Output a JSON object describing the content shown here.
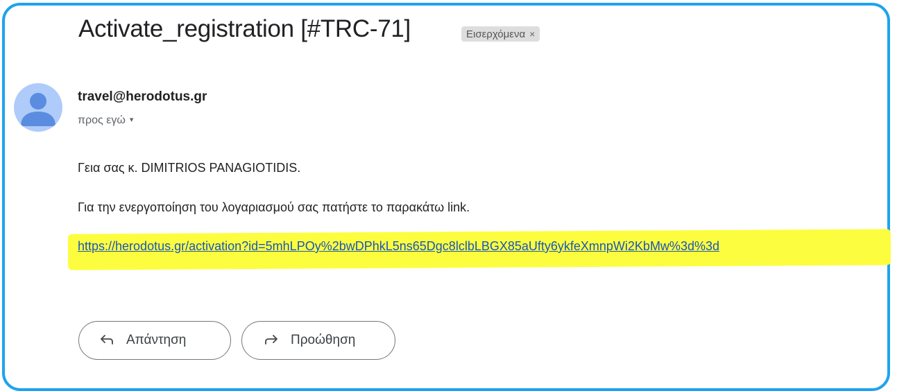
{
  "email": {
    "subject": "Activate_registration [#TRC-71]",
    "label": "Εισερχόμενα",
    "label_remove": "×",
    "sender": "travel@herodotus.gr",
    "recipient": "προς εγώ",
    "recipient_caret": "▾",
    "body": {
      "greeting": "Γεια σας κ. DIMITRIOS PANAGIOTIDIS.",
      "instruction": "Για την ενεργοποίηση του λογαριασμού σας πατήστε το παρακάτω link.",
      "link": "https://herodotus.gr/activation?id=5mhLPOy%2bwDPhkL5ns65Dgc8lclbLBGX85aUfty6ykfeXmnpWi2KbMw%3d%3d"
    }
  },
  "actions": {
    "reply_label": "Απάντηση",
    "forward_label": "Προώθηση"
  },
  "icons": {
    "avatar": "person-icon",
    "reply": "reply-arrow-icon",
    "forward": "forward-arrow-icon"
  },
  "colors": {
    "frame_border": "#1ea3ee",
    "highlight": "#fdfd3f",
    "link": "#1a56b8",
    "avatar_bg": "#aecbfa",
    "avatar_fg": "#5a8de0"
  }
}
